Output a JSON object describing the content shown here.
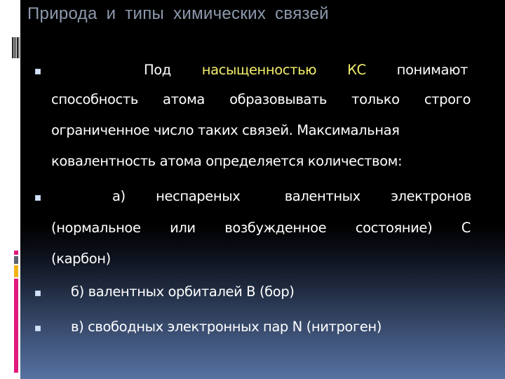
{
  "slide": {
    "title": "Природа и типы химических связей",
    "colors": {
      "title": "#8d99ad",
      "body_text": "#ffffff",
      "highlight": "#f2ee6a",
      "bullet": "#d3e2f6",
      "accent_pink": "#e0197d",
      "accent_gray": "#5b6270",
      "accent_yellow": "#f4b21a"
    },
    "bullets": [
      {
        "lines": [
          [
            "Под",
            "насыщенностью",
            "КС",
            "понимают"
          ],
          [
            "способность",
            "атома",
            "образовывать",
            "только",
            "строго"
          ],
          "ограниченное число таких связей. Максимальная",
          "ковалентность атома определяется количеством:"
        ],
        "highlighted_terms": [
          "насыщенностью",
          "КС"
        ]
      },
      {
        "lines": [
          [
            "а)",
            "неспареных",
            "валентных",
            "электронов"
          ],
          [
            "(нормальное",
            "или",
            "возбужденное",
            "состояние)",
            "С"
          ],
          "(карбон)"
        ]
      },
      {
        "lines": [
          "б) валентных орбиталей В (бор)"
        ]
      },
      {
        "lines": [
          "в) свободных электронных пар N (нитроген)"
        ]
      }
    ]
  }
}
